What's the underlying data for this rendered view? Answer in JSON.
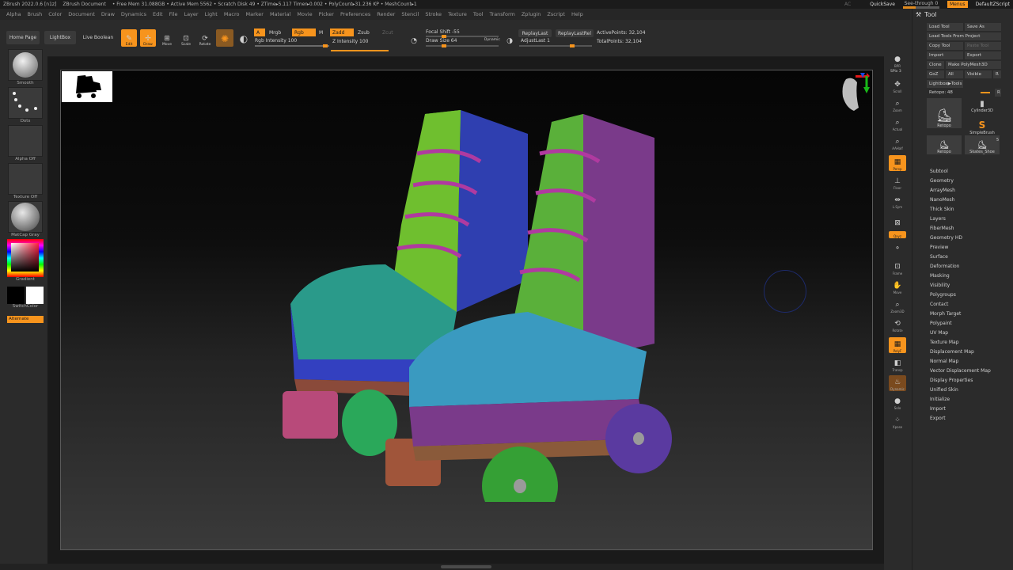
{
  "titlebar": {
    "app": "ZBrush 2022.0.6 [n1z]",
    "document": "ZBrush Document",
    "stats": "• Free Mem 31.088GB • Active Mem 5562 • Scratch Disk 49 • ZTime▸5.117 Timer▸0.002 • PolyCount▸31.236 KP • MeshCount▸1",
    "ac": "AC",
    "quicksave": "QuickSave",
    "see_through": "See-through  0",
    "menus": "Menus",
    "script": "DefaultZScript"
  },
  "menus": [
    "Alpha",
    "Brush",
    "Color",
    "Document",
    "Draw",
    "Dynamics",
    "Edit",
    "File",
    "Layer",
    "Light",
    "Macro",
    "Marker",
    "Material",
    "Movie",
    "Picker",
    "Preferences",
    "Render",
    "Stencil",
    "Stroke",
    "Texture",
    "Tool",
    "Transform",
    "Zplugin",
    "Zscript",
    "Help"
  ],
  "shelf": {
    "home_page": "Home Page",
    "lightbox": "LightBox",
    "live_boolean": "Live Boolean",
    "edit": "Edit",
    "draw": "Draw",
    "move": "Move",
    "scale": "Scale",
    "rotate": "Rotate",
    "a": "A",
    "mrgb": "Mrgb",
    "rgb": "Rgb",
    "m": "M",
    "zadd": "Zadd",
    "zsub": "Zsub",
    "zcut": "Zcut",
    "rgb_intensity": "Rgb Intensity 100",
    "z_intensity": "Z Intensity 100",
    "focal_shift": "Focal Shift -55",
    "draw_size": "Draw Size 64",
    "dynamic": "Dynamic",
    "replay_last": "ReplayLast",
    "replay_last_rel": "ReplayLastRel",
    "adjust_last": "AdjustLast 1",
    "active_points": "ActivePoints: 32,104",
    "total_points": "TotalPoints: 32,104"
  },
  "left": {
    "smooth": "Smooth",
    "dots": "Dots",
    "alpha_off": "Alpha Off",
    "texture_off": "Texture Off",
    "matcap": "MatCap Gray",
    "gradient": "Gradient",
    "switch_color": "SwitchColor",
    "alternate": "Alternate"
  },
  "right_shelf": {
    "bpr": "BPR",
    "spix": "SPix 3",
    "scroll": "Scroll",
    "zoom": "Zoom",
    "actual": "Actual",
    "aahalf": "AAHalf",
    "persp": "Persp",
    "floor": "Floor",
    "lsym": "L.Sym",
    "xyz": "Qxyz",
    "frame": "Frame",
    "move": "Move",
    "zoom3d": "Zoom3D",
    "rotate": "Rotate",
    "polyf": "PolyF",
    "transp": "Transp",
    "dynamic": "Dynamic",
    "solo": "Solo",
    "xpose": "Xpose"
  },
  "tool": {
    "title": "Tool",
    "load_tool": "Load Tool",
    "save_as": "Save As",
    "load_from_project": "Load Tools From Project",
    "copy_tool": "Copy Tool",
    "paste_tool": "Paste Tool",
    "import": "Import",
    "export": "Export",
    "clone": "Clone",
    "make_polymesh": "Make PolyMesh3D",
    "goz": "GoZ",
    "all": "All",
    "visible": "Visible",
    "r": "R",
    "lightbox_tools": "Lightbox▶Tools",
    "retopo": "Retopo: 48",
    "r2": "R",
    "thumbs": [
      "Retopo",
      "Cylinder3D",
      "SimpleBrush",
      "Retopo",
      "Skates_Shoe"
    ],
    "thumb_count": "5",
    "sections": [
      "Subtool",
      "Geometry",
      "ArrayMesh",
      "NanoMesh",
      "Thick Skin",
      "Layers",
      "FiberMesh",
      "Geometry HD",
      "Preview",
      "Surface",
      "Deformation",
      "Masking",
      "Visibility",
      "Polygroups",
      "Contact",
      "Morph Target",
      "Polypaint",
      "UV Map",
      "Texture Map",
      "Displacement Map",
      "Normal Map",
      "Vector Displacement Map",
      "Display Properties",
      "Unified Skin",
      "Initialize",
      "Import",
      "Export"
    ]
  }
}
